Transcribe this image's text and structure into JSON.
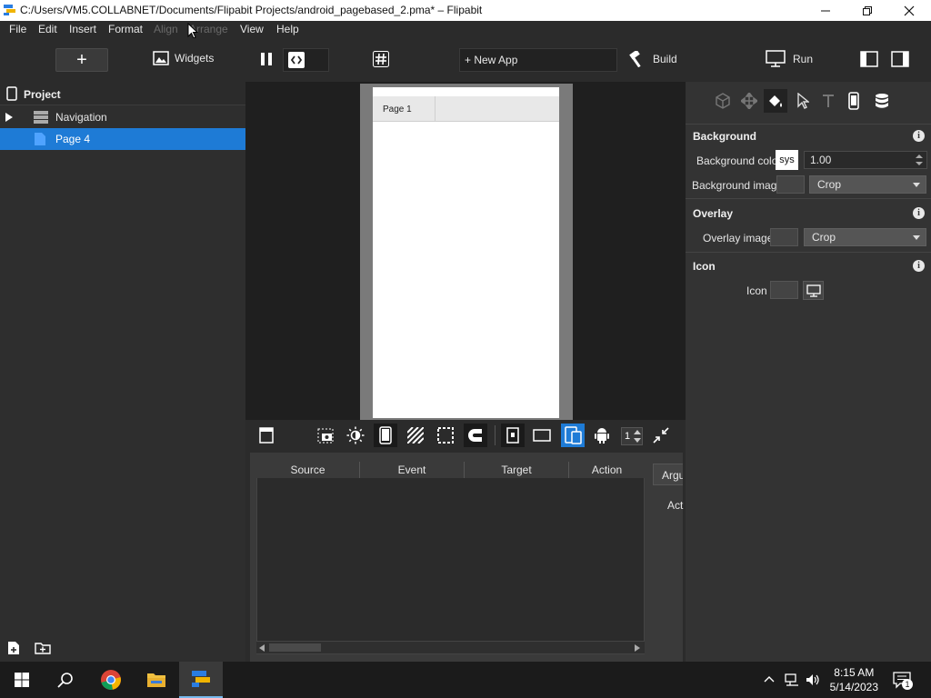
{
  "window": {
    "title": "C:/Users/VM5.COLLABNET/Documents/Flipabit Projects/android_pagebased_2.pma* – Flipabit",
    "minimize": "—",
    "maximize": "❐",
    "close": "✕"
  },
  "menu": {
    "items": [
      "File",
      "Edit",
      "Insert",
      "Format",
      "Align",
      "Arrange",
      "View",
      "Help"
    ]
  },
  "toolbar": {
    "add": "+",
    "widgets": "Widgets",
    "new_app": "+ New App",
    "build": "Build",
    "run": "Run"
  },
  "project": {
    "header": "Project",
    "items": [
      {
        "label": "Navigation",
        "selected": false
      },
      {
        "label": "Page 4",
        "selected": true
      }
    ]
  },
  "canvas": {
    "tab_label": "Page 1",
    "spin_value": "1"
  },
  "events": {
    "columns": [
      "Source",
      "Event",
      "Target",
      "Action"
    ],
    "side_tab": "Argu",
    "side_label": "Act"
  },
  "properties": {
    "background": {
      "title": "Background",
      "color_label": "Background color",
      "color_button": "sys",
      "opacity_value": "1.00",
      "image_label": "Background image",
      "image_mode": "Crop"
    },
    "overlay": {
      "title": "Overlay",
      "image_label": "Overlay image",
      "image_mode": "Crop"
    },
    "icon": {
      "title": "Icon",
      "label": "Icon"
    }
  },
  "taskbar": {
    "time": "8:15 AM",
    "date": "5/14/2023",
    "notification_count": "1"
  },
  "colors": {
    "accent": "#1e7bd6",
    "panel": "#333333",
    "background": "#2b2b2b"
  }
}
